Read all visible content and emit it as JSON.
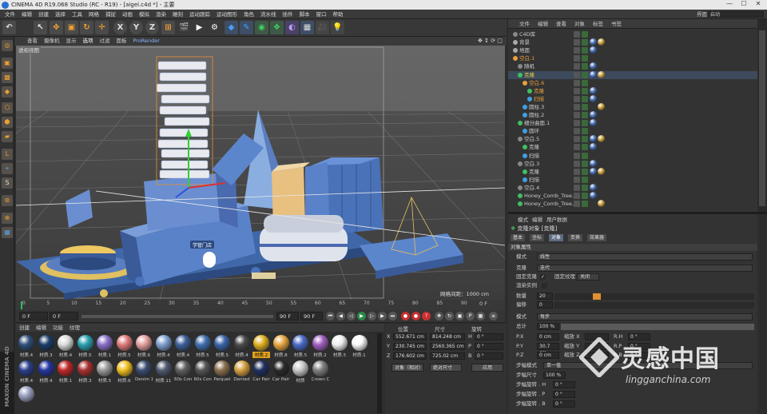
{
  "window": {
    "title": "CINEMA 4D R19.068 Studio (RC - R19) - [aigei.c4d *] - 主要",
    "controls": [
      "—",
      "☐",
      "✕"
    ]
  },
  "menubar": [
    "文件",
    "编辑",
    "创建",
    "选择",
    "工具",
    "网格",
    "捕捉",
    "动画",
    "模拟",
    "渲染",
    "雕刻",
    "运动跟踪",
    "运动图形",
    "角色",
    "流水线",
    "插件",
    "脚本",
    "窗口",
    "帮助"
  ],
  "layout": {
    "label": "界面",
    "value": "启动"
  },
  "toolbar": {
    "icons": [
      "undo-icon",
      "select-icon",
      "move-icon",
      "scale-icon",
      "rotate-icon",
      "transform-icon",
      "x-axis-icon",
      "y-axis-icon",
      "z-axis-icon",
      "coord-icon",
      "render-view-icon",
      "render-icon",
      "render-settings-icon",
      "cube-icon",
      "pen-icon",
      "subdivision-icon",
      "cloner-icon",
      "deformer-icon",
      "floor-icon",
      "camera-icon",
      "light-icon"
    ],
    "axis_labels": [
      "X",
      "Y",
      "Z"
    ]
  },
  "viewport": {
    "menu": [
      "查看",
      "摄像机",
      "显示",
      "选项",
      "过滤",
      "面板",
      "ProRender"
    ],
    "label": "透视视图",
    "grid_info": "网格间距：1000 cm",
    "scene_label": "学管门店"
  },
  "timeline": {
    "ticks": [
      "0",
      "5",
      "10",
      "15",
      "20",
      "25",
      "30",
      "35",
      "40",
      "45",
      "50",
      "55",
      "60",
      "65",
      "70",
      "75",
      "80",
      "85",
      "90"
    ],
    "end_label": "0 F"
  },
  "transport": {
    "start": "0 F",
    "current": "0 F",
    "end": "90 F",
    "end2": "90 F"
  },
  "materials": {
    "tabs": [
      "创建",
      "编辑",
      "功能",
      "纹理"
    ],
    "items": [
      {
        "name": "材质.4",
        "color": "#2f4f7a"
      },
      {
        "name": "材质.3",
        "color": "#1c3c68"
      },
      {
        "name": "材质.4",
        "color": "#dcdcdc"
      },
      {
        "name": "材质.5",
        "color": "#2aa0b0"
      },
      {
        "name": "材质.1",
        "color": "#8a70c8"
      },
      {
        "name": "材质.5",
        "color": "#e07a7a"
      },
      {
        "name": "材质.6",
        "color": "#e4a0a0"
      },
      {
        "name": "材质.4",
        "color": "#7f9fd0"
      },
      {
        "name": "材质.4",
        "color": "#3e5f9a"
      },
      {
        "name": "材质.5",
        "color": "#4070b0"
      },
      {
        "name": "材质.5",
        "color": "#3a64a8"
      },
      {
        "name": "材质.4",
        "color": "#4a4a4a"
      },
      {
        "name": "材质.2",
        "color": "#e0b020"
      },
      {
        "name": "材质.8",
        "color": "#e8a840"
      },
      {
        "name": "材质.5",
        "color": "#4b6bc8"
      },
      {
        "name": "材质.2",
        "color": "#a060c0"
      },
      {
        "name": "材质.5",
        "color": "#f0f0f0"
      },
      {
        "name": "材质.1",
        "color": "#fafafa"
      },
      {
        "name": "材质.4",
        "color": "#2a3f8a"
      },
      {
        "name": "材质.4",
        "color": "#2436a0"
      },
      {
        "name": "材质.1",
        "color": "#c02828"
      },
      {
        "name": "材质.3",
        "color": "#a83030"
      },
      {
        "name": "材质.5",
        "color": "#9a9a9a"
      },
      {
        "name": "材质.6",
        "color": "#f0c020"
      },
      {
        "name": "Denim 1",
        "color": "#3a4c70"
      },
      {
        "name": "材质.11",
        "color": "#505a70"
      },
      {
        "name": "60s Con",
        "color": "#606060"
      },
      {
        "name": "60s Con",
        "color": "#555555"
      },
      {
        "name": "Parquet",
        "color": "#8a7050"
      },
      {
        "name": "Dented",
        "color": "#d4a040"
      },
      {
        "name": "Car Pair",
        "color": "#203060"
      },
      {
        "name": "Car Pair",
        "color": "#2a2a2a"
      },
      {
        "name": "材质",
        "color": "#c8c8c8"
      },
      {
        "name": "Crown C",
        "color": "#808080"
      },
      {
        "name": "",
        "color": "#9aa0c0"
      }
    ],
    "brand": "MAXON CINEMA 4D"
  },
  "coordinates": {
    "headers": [
      "位置",
      "尺寸",
      "旋转"
    ],
    "rows": [
      {
        "axis": "X",
        "pos": "552.671 cm",
        "size": "814.248 cm",
        "rot_axis": "H",
        "rot": "0 °"
      },
      {
        "axis": "Y",
        "pos": "230.745 cm",
        "size": "2560.365 cm",
        "rot_axis": "P",
        "rot": "0 °"
      },
      {
        "axis": "Z",
        "pos": "176.602 cm",
        "size": "725.02 cm",
        "rot_axis": "B",
        "rot": "0 °"
      }
    ],
    "mode1": "对象（相对）",
    "mode2": "绝对尺寸",
    "apply": "应用"
  },
  "objects": {
    "menu": [
      "文件",
      "编辑",
      "查看",
      "对象",
      "标签",
      "书签"
    ],
    "rows": [
      {
        "name": "C4D库",
        "indent": 0,
        "color": "#ccc",
        "dot": "#888"
      },
      {
        "name": "背景",
        "indent": 0,
        "color": "#ccc",
        "dot": "#aaa"
      },
      {
        "name": "地面",
        "indent": 0,
        "color": "#ccc",
        "dot": "#aaa"
      },
      {
        "name": "空白.1",
        "indent": 0,
        "color": "#e8a040",
        "dot": "#e8a040"
      },
      {
        "name": "随机",
        "indent": 1,
        "color": "#ccc",
        "dot": "#888"
      },
      {
        "name": "克隆",
        "indent": 1,
        "color": "#e8d040",
        "dot": "#40c060"
      },
      {
        "name": "空白.6",
        "indent": 2,
        "color": "#e8a040",
        "dot": "#e8a040"
      },
      {
        "name": "克隆",
        "indent": 3,
        "color": "#e8a040",
        "dot": "#40c060"
      },
      {
        "name": "扫描",
        "indent": 3,
        "color": "#e8a040",
        "dot": "#40a0e0"
      },
      {
        "name": "圆柱.3",
        "indent": 2,
        "color": "#ccc",
        "dot": "#40a0e0"
      },
      {
        "name": "圆柱.2",
        "indent": 2,
        "color": "#ccc",
        "dot": "#40a0e0"
      },
      {
        "name": "细分曲面.1",
        "indent": 1,
        "color": "#ccc",
        "dot": "#40c060"
      },
      {
        "name": "圆环",
        "indent": 2,
        "color": "#ccc",
        "dot": "#40a0e0"
      },
      {
        "name": "空白.5",
        "indent": 1,
        "color": "#ccc",
        "dot": "#888"
      },
      {
        "name": "克隆",
        "indent": 2,
        "color": "#ccc",
        "dot": "#40c060"
      },
      {
        "name": "扫描",
        "indent": 2,
        "color": "#ccc",
        "dot": "#40a0e0"
      },
      {
        "name": "空白.3",
        "indent": 1,
        "color": "#ccc",
        "dot": "#888"
      },
      {
        "name": "克隆",
        "indent": 2,
        "color": "#ccc",
        "dot": "#40c060"
      },
      {
        "name": "扫描",
        "indent": 2,
        "color": "#ccc",
        "dot": "#40a0e0"
      },
      {
        "name": "空白.4",
        "indent": 1,
        "color": "#ccc",
        "dot": "#888"
      },
      {
        "name": "Honey_Comb_Tree.4",
        "indent": 1,
        "color": "#ccc",
        "dot": "#40c060"
      },
      {
        "name": "Honey_Comb_Tree.3",
        "indent": 1,
        "color": "#ccc",
        "dot": "#40c060"
      }
    ]
  },
  "attributes": {
    "menu": [
      "模式",
      "编辑",
      "用户数据"
    ],
    "object_title": "克隆对象 [克隆]",
    "tabs": [
      "基本",
      "坐标",
      "对象",
      "变换",
      "效果器"
    ],
    "active_tab": "对象",
    "section": "对象属性",
    "mode_label": "模式",
    "mode_value": "线性",
    "clone_label": "克隆",
    "clone_value": "迭代",
    "fix_clone": "固定克隆",
    "fix_texture": "固定纹理",
    "fix_texture_value": "关闭",
    "render_instances": "渲染实例",
    "count_label": "数量",
    "count_value": "20",
    "count_fraction": 0.04,
    "offset_label": "偏移",
    "offset_value": "0",
    "mode2_label": "模式",
    "mode2_value": "每步",
    "total_label": "总计",
    "total_value": "100 %",
    "pos_rows": [
      {
        "axis": "P.X",
        "val": "0 cm",
        "s": "S.X",
        "sval": "",
        "r": "R.H",
        "rval": "0 °"
      },
      {
        "axis": "P.Y",
        "val": "30.7 cm",
        "s": "S.Y",
        "sval": "",
        "r": "R.P",
        "rval": "0 °"
      },
      {
        "axis": "P.Z",
        "val": "0 cm",
        "s": "S.Z",
        "sval": "",
        "r": "R.B",
        "rval": "0 °"
      }
    ],
    "scale_rows": [
      "缩放 X",
      "缩放 Y",
      "缩放 Z"
    ],
    "step_mode_label": "步幅模式",
    "step_mode_value": "单一值",
    "step_size_label": "步幅尺寸",
    "step_size_value": "100 %",
    "step_rot_h": "步幅旋转 . H",
    "step_rot_p": "步幅旋转 . P",
    "step_rot_b": "步幅旋转 . B",
    "zero": "0 °"
  },
  "watermark": {
    "cn": "灵感中国",
    "en": "lingganchina.com"
  }
}
